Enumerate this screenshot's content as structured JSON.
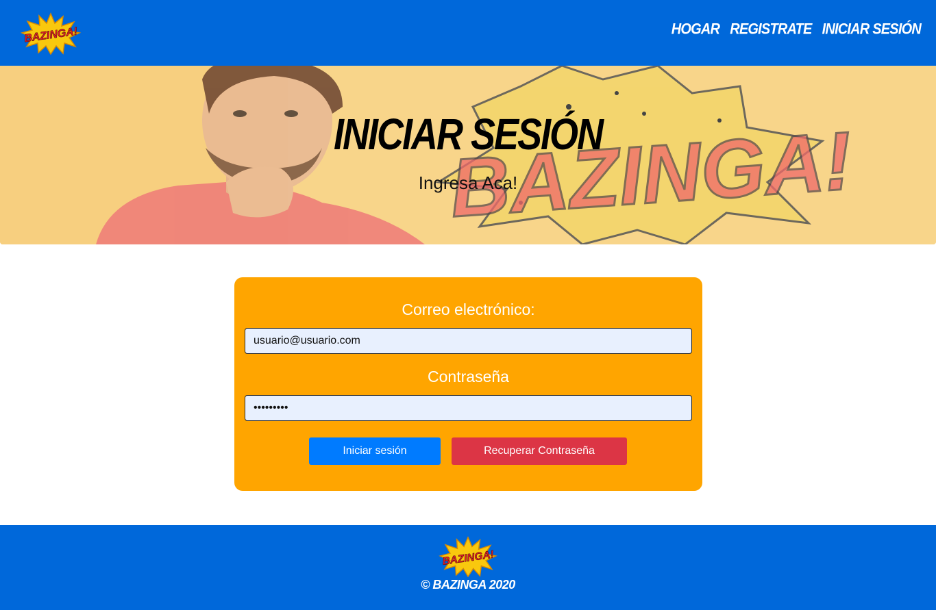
{
  "brand": {
    "logo_text": "BAZINGA!",
    "colors": {
      "primary": "#0068da",
      "accent": "#ffa500",
      "danger": "#dc3545",
      "button": "#007bff"
    }
  },
  "nav": {
    "items": [
      {
        "label": "HOGAR"
      },
      {
        "label": "REGISTRATE"
      },
      {
        "label": "INICIAR SESIÓN"
      }
    ]
  },
  "hero": {
    "title": "INICIAR SESIÓN",
    "subtitle": "Ingresa Aca!",
    "background_text": "BAZINGA!"
  },
  "form": {
    "email_label": "Correo electrónico:",
    "email_value": "usuario@usuario.com",
    "password_label": "Contraseña",
    "password_value": "123456789",
    "submit_label": "Iniciar sesión",
    "recover_label": "Recuperar Contraseña"
  },
  "footer": {
    "copyright": "© BAZINGA 2020"
  }
}
